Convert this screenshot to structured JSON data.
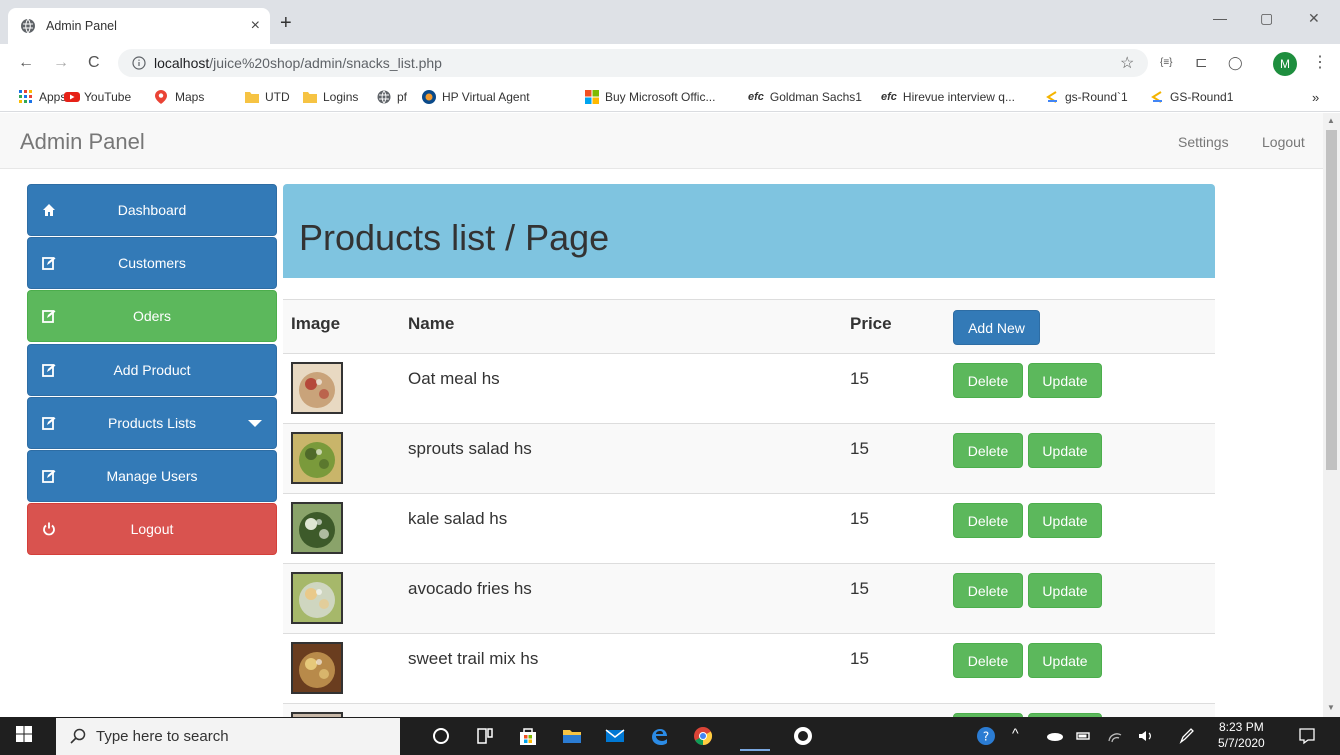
{
  "browser": {
    "tab_title": "Admin Panel",
    "tab_close": "×",
    "new_tab": "+",
    "url_host": "localhost",
    "url_path": "/juice%20shop/admin/snacks_list.php",
    "window_controls": [
      "—",
      "▢",
      "✕"
    ],
    "nav": {
      "back": "←",
      "forward": "→",
      "reload": "C"
    },
    "toolbar_icons": [
      "☆",
      "{≡}",
      "⊏",
      "◯",
      "⋮"
    ],
    "profile_initial": "M"
  },
  "bookmarks": [
    {
      "label": "Apps",
      "icon": "apps-grid-icon"
    },
    {
      "label": "YouTube",
      "icon": "youtube-icon"
    },
    {
      "label": "Maps",
      "icon": "maps-pin-icon"
    },
    {
      "label": "UTD",
      "icon": "folder-icon"
    },
    {
      "label": "Logins",
      "icon": "folder-icon"
    },
    {
      "label": "pf",
      "icon": "globe-icon"
    },
    {
      "label": "HP Virtual Agent",
      "icon": "hp-icon"
    },
    {
      "label": "Buy Microsoft Offic...",
      "icon": "microsoft-icon"
    },
    {
      "label": "Goldman Sachs1",
      "icon": "efc-icon",
      "prefix": "efc"
    },
    {
      "label": "Hirevue interview q...",
      "icon": "efc-icon",
      "prefix": "efc"
    },
    {
      "label": "gs-Round`1",
      "icon": "gs-icon"
    },
    {
      "label": "GS-Round1",
      "icon": "gs-icon"
    }
  ],
  "bookmarks_more": "»",
  "navbar": {
    "brand": "Admin Panel",
    "settings": "Settings",
    "logout": "Logout"
  },
  "sidebar": [
    {
      "label": "Dashboard",
      "style": "blue",
      "icon": "home-icon"
    },
    {
      "label": "Customers",
      "style": "blue",
      "icon": "edit-icon"
    },
    {
      "label": "Oders",
      "style": "green",
      "icon": "edit-icon"
    },
    {
      "label": "Add Product",
      "style": "blue",
      "icon": "edit-icon"
    },
    {
      "label": "Products Lists",
      "style": "blue",
      "icon": "edit-icon",
      "caret": true
    },
    {
      "label": "Manage Users",
      "style": "blue",
      "icon": "edit-icon"
    },
    {
      "label": "Logout",
      "style": "red",
      "icon": "power-icon"
    }
  ],
  "main": {
    "title": "Products list / Page",
    "table": {
      "headers": {
        "image": "Image",
        "name": "Name",
        "price": "Price"
      },
      "add_new": "Add New",
      "delete_label": "Delete",
      "update_label": "Update",
      "rows": [
        {
          "name": "Oat meal hs",
          "price": "15",
          "colors": [
            "#c9a37a",
            "#e8d9c2",
            "#b5483a"
          ]
        },
        {
          "name": "sprouts salad hs",
          "price": "15",
          "colors": [
            "#7a9a3b",
            "#c9b56a",
            "#4f6a2a"
          ]
        },
        {
          "name": "kale salad hs",
          "price": "15",
          "colors": [
            "#3d5a2a",
            "#8aa36a",
            "#dfe6d3"
          ]
        },
        {
          "name": "avocado fries hs",
          "price": "15",
          "colors": [
            "#cfd6c0",
            "#a6b86a",
            "#e9c98a"
          ]
        },
        {
          "name": "sweet trail mix hs",
          "price": "15",
          "colors": [
            "#b88a4a",
            "#6a3d1f",
            "#e6c87a"
          ]
        },
        {
          "name": "",
          "price": "",
          "colors": [
            "#8c7a6a",
            "#c8b8a8",
            "#5a4a3a"
          ]
        }
      ]
    }
  },
  "taskbar": {
    "search_placeholder": "Type here to search",
    "time": "8:23 PM",
    "date": "5/7/2020"
  }
}
